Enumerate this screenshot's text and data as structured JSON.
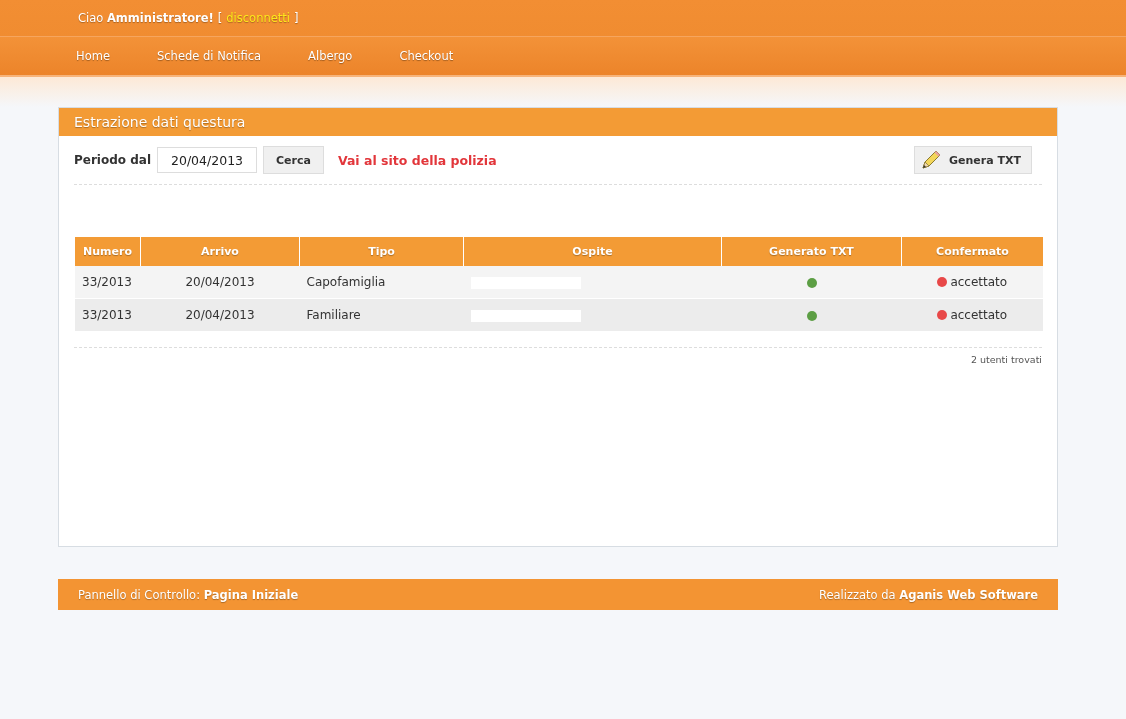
{
  "header": {
    "greeting": "Ciao",
    "user": "Amministratore!",
    "bracket_open": "[",
    "logout_link": "disconnetti",
    "bracket_close": "]"
  },
  "nav": [
    {
      "label": "Home"
    },
    {
      "label": "Schede di Notifica"
    },
    {
      "label": "Albergo"
    },
    {
      "label": "Checkout"
    }
  ],
  "panel": {
    "title": "Estrazione dati questura",
    "period_label": "Periodo dal",
    "period_value": "20/04/2013",
    "search_button": "Cerca",
    "police_link": "Vai al sito della polizia",
    "generate_button": "Genera TXT"
  },
  "table": {
    "columns": [
      "Numero",
      "Arrivo",
      "Tipo",
      "Ospite",
      "Generato TXT",
      "Confermato"
    ],
    "rows": [
      {
        "numero": "33/2013",
        "arrivo": "20/04/2013",
        "tipo": "Capofamiglia",
        "ospite_redacted": true,
        "txt_generated": true,
        "confirmed": false,
        "confirmed_label": "accettato"
      },
      {
        "numero": "33/2013",
        "arrivo": "20/04/2013",
        "tipo": "Familiare",
        "ospite_redacted": true,
        "txt_generated": true,
        "confirmed": false,
        "confirmed_label": "accettato"
      }
    ],
    "count": "2 utenti trovati"
  },
  "footer": {
    "left_label": "Pannello di Controllo:",
    "left_page": "Pagina Iniziale",
    "right_label": "Realizzato da",
    "right_author": "Aganis Web Software"
  }
}
